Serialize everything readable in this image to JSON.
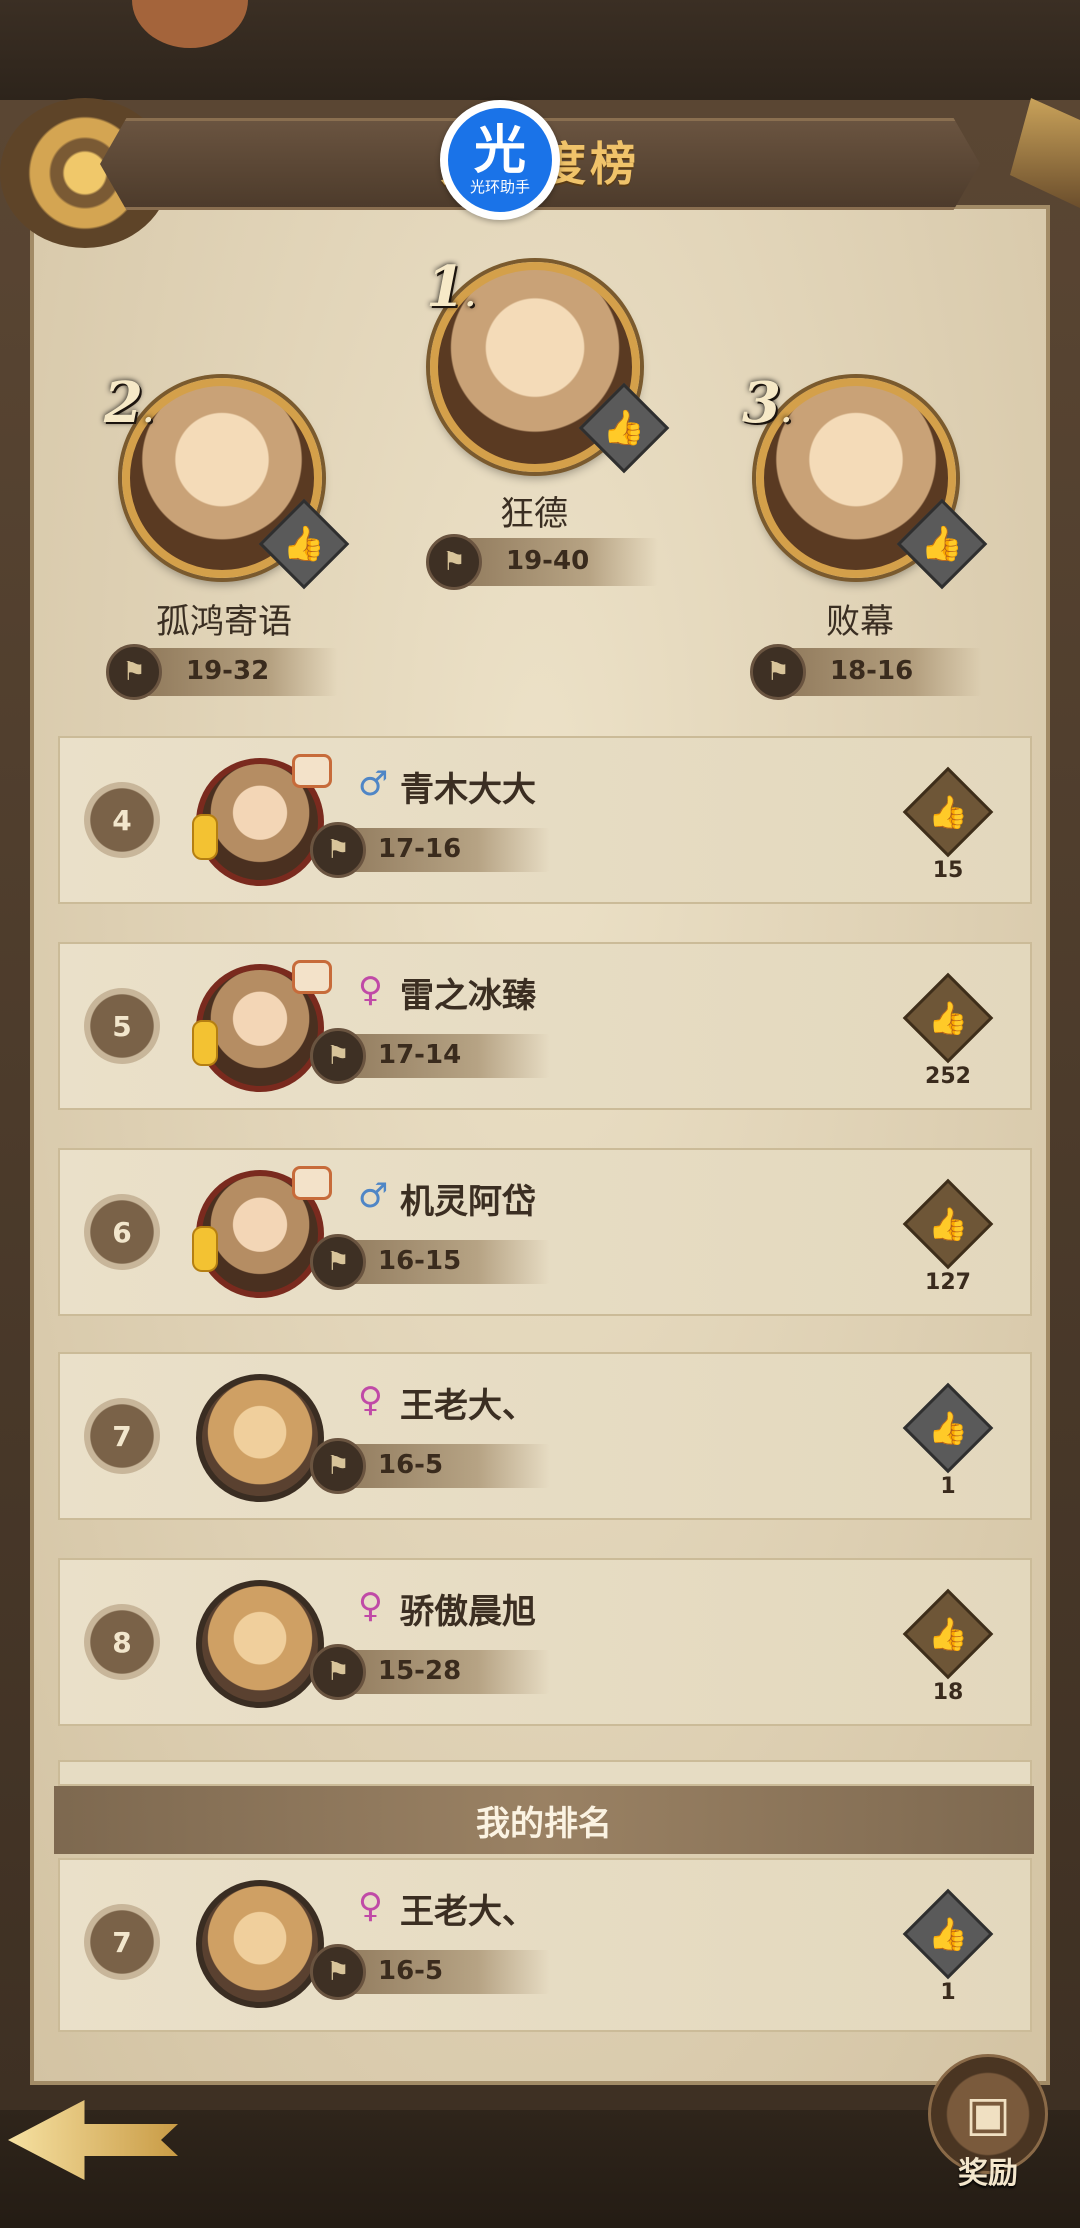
{
  "header": {
    "title": "关注度榜",
    "watermark_big": "光",
    "watermark_small": "光环助手"
  },
  "podium": [
    {
      "rank": "1",
      "name": "狂德",
      "score": "19-40",
      "like_state": "grey"
    },
    {
      "rank": "2",
      "name": "孤鸿寄语",
      "score": "19-32",
      "like_state": "grey"
    },
    {
      "rank": "3",
      "name": "败幕",
      "score": "18-16",
      "like_state": "grey"
    }
  ],
  "rows": [
    {
      "rank": "4",
      "gender": "♂",
      "name": "青木大大",
      "score": "17-16",
      "likes": "15",
      "like_state": "gold"
    },
    {
      "rank": "5",
      "gender": "♀",
      "name": "雷之冰臻",
      "score": "17-14",
      "likes": "252",
      "like_state": "gold"
    },
    {
      "rank": "6",
      "gender": "♂",
      "name": "机灵阿岱",
      "score": "16-15",
      "likes": "127",
      "like_state": "gold"
    },
    {
      "rank": "7",
      "gender": "♀",
      "name": "王老大、",
      "score": "16-5",
      "likes": "1",
      "like_state": "grey"
    },
    {
      "rank": "8",
      "gender": "♀",
      "name": "骄傲晨旭",
      "score": "15-28",
      "likes": "18",
      "like_state": "gold"
    }
  ],
  "my_rank": {
    "header": "我的排名",
    "rank": "7",
    "gender": "♀",
    "name": "王老大、",
    "score": "16-5",
    "likes": "1",
    "like_state": "grey"
  },
  "footer": {
    "reward_label": "奖励"
  },
  "icons": {
    "thumb": "👍",
    "flag": "⚑",
    "back": "back-arrow-icon",
    "chest": "treasure-chest-icon"
  },
  "colors": {
    "gold_frame": "#d4a04a",
    "title_gold": "#f0c36a",
    "male": "#4f86c6",
    "female": "#c04aa7"
  }
}
